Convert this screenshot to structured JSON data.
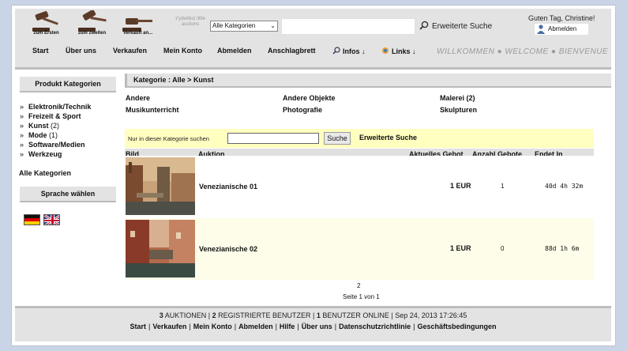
{
  "header": {
    "gavels": [
      "zum Ersten",
      "zum zweiten",
      "Verkauft an..."
    ],
    "tagline": "z'ydwitloz little auctions",
    "category_select": "Alle Kategorien",
    "search_link": "Erweiterte Suche",
    "greeting": "Guten Tag, Christine!",
    "logout": "Abmelden",
    "nav": [
      "Start",
      "Über uns",
      "Verkaufen",
      "Mein Konto",
      "Abmelden",
      "Anschlagbrett",
      "Infos ↓",
      "Links ↓"
    ],
    "welcome": "WILLKOMMEN ● WELCOME ● BIENVENUE"
  },
  "sidebar": {
    "categories_title": "Produkt Kategorien",
    "items": [
      {
        "label": "Elektronik/Technik",
        "count": ""
      },
      {
        "label": "Freizeit & Sport",
        "count": ""
      },
      {
        "label": "Kunst",
        "count": "(2)"
      },
      {
        "label": "Mode",
        "count": "(1)"
      },
      {
        "label": "Software/Medien",
        "count": ""
      },
      {
        "label": "Werkzeug",
        "count": ""
      }
    ],
    "all_categories": "Alle Kategorien",
    "language_title": "Sprache wählen"
  },
  "main": {
    "breadcrumb": "Kategorie : Alle > Kunst",
    "subcategories": [
      {
        "label": "Andere",
        "count": ""
      },
      {
        "label": "Andere Objekte",
        "count": ""
      },
      {
        "label": "Malerei",
        "count": "(2)"
      },
      {
        "label": "Musikunterricht",
        "count": ""
      },
      {
        "label": "Photografie",
        "count": ""
      },
      {
        "label": "Skulpturen",
        "count": ""
      }
    ],
    "filter": {
      "label": "Nur in dieser Kategorie suchen",
      "button": "Suche",
      "advanced": "Erweiterte Suche"
    },
    "table": {
      "headers": [
        "Bild",
        "Auktion",
        "Aktuelles Gebot",
        "Anzahl Gebote",
        "Endet In"
      ],
      "rows": [
        {
          "title": "Venezianische 01",
          "price_value": "1",
          "currency": "EUR",
          "bids": "1",
          "ends": "40d 4h 32m"
        },
        {
          "title": "Venezianische 02",
          "price_value": "1",
          "currency": "EUR",
          "bids": "0",
          "ends": "88d 1h 6m"
        }
      ]
    },
    "pagination": {
      "number": "2",
      "info": "Seite 1 von 1"
    }
  },
  "footer": {
    "stats": {
      "auctions_count": "3",
      "auctions_label": "AUKTIONEN |",
      "users_count": "2",
      "users_label": "REGISTRIERTE BENUTZER |",
      "online_count": "1",
      "online_label": "BENUTZER ONLINE | Sep 24, 2013 17:26:45"
    },
    "links": [
      "Start",
      "Verkaufen",
      "Mein Konto",
      "Abmelden",
      "Hilfe",
      "Über uns",
      "Datenschutzrichtlinie",
      "Geschäftsbedingungen"
    ]
  },
  "colors": {
    "background": "#c9d5e6",
    "header_gray": "#e3e3e3",
    "filter_yellow": "#ffffc0",
    "row_alt": "#fdfde9"
  }
}
